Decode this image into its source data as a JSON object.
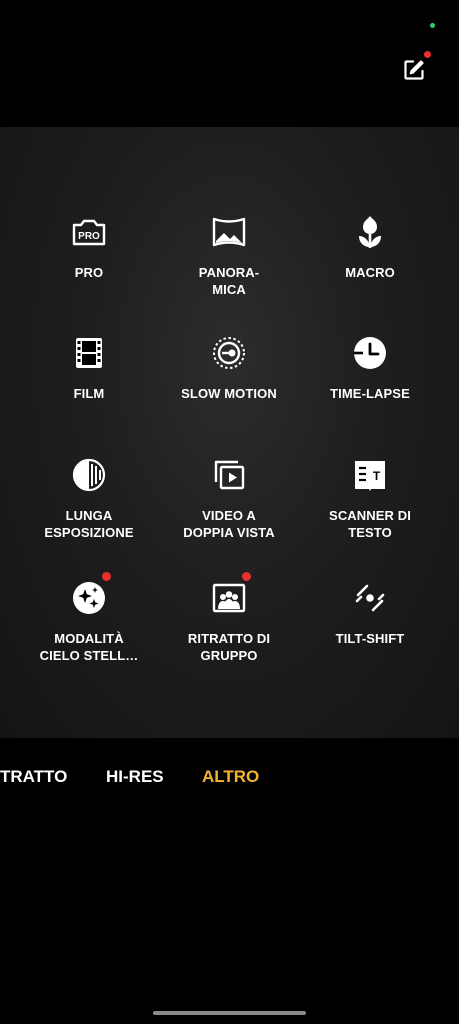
{
  "colors": {
    "accent": "#f5b331",
    "badge": "#e8312e",
    "status_dot": "#2ecc71"
  },
  "top_bar": {
    "edit_icon": "edit-square-icon"
  },
  "modes": [
    {
      "label": "PRO",
      "icon": "pro-icon",
      "badge": false
    },
    {
      "label": "PANORA-\nMICA",
      "icon": "panorama-icon",
      "badge": false
    },
    {
      "label": "MACRO",
      "icon": "macro-tulip-icon",
      "badge": false
    },
    {
      "label": "FILM",
      "icon": "film-icon",
      "badge": false
    },
    {
      "label": "SLOW MOTION",
      "icon": "slow-motion-icon",
      "badge": false
    },
    {
      "label": "TIME-LAPSE",
      "icon": "time-lapse-clock-icon",
      "badge": false
    },
    {
      "label": "LUNGA\nESPOSIZIONE",
      "icon": "long-exposure-icon",
      "badge": false
    },
    {
      "label": "VIDEO A\nDOPPIA VISTA",
      "icon": "dual-view-video-icon",
      "badge": false
    },
    {
      "label": "SCANNER DI\nTESTO",
      "icon": "text-scanner-icon",
      "badge": false
    },
    {
      "label": "MODALITÀ\nCIELO STELL…",
      "icon": "starry-sky-icon",
      "badge": true
    },
    {
      "label": "RITRATTO DI\nGRUPPO",
      "icon": "group-portrait-icon",
      "badge": true
    },
    {
      "label": "TILT-SHIFT",
      "icon": "tilt-shift-icon",
      "badge": false
    }
  ],
  "tabs": [
    {
      "label": "TRATTO",
      "active": false
    },
    {
      "label": "HI-RES",
      "active": false
    },
    {
      "label": "ALTRO",
      "active": true
    }
  ]
}
